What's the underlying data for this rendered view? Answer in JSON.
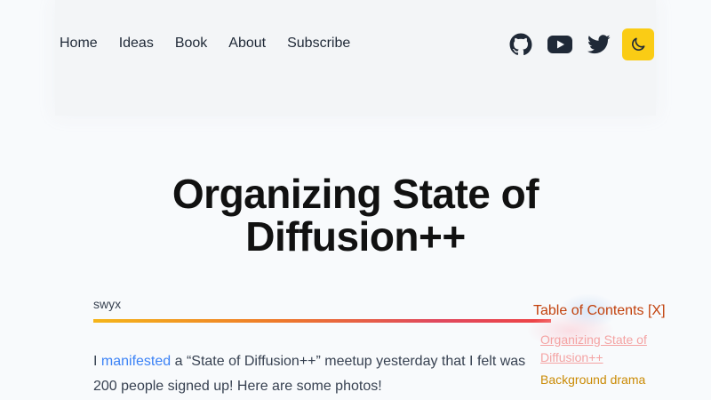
{
  "nav": {
    "items": [
      {
        "label": "Home"
      },
      {
        "label": "Ideas"
      },
      {
        "label": "Book"
      },
      {
        "label": "About"
      },
      {
        "label": "Subscribe"
      }
    ]
  },
  "social": {
    "icons": [
      "github-icon",
      "youtube-icon",
      "twitter-icon"
    ],
    "theme_toggle_icon": "moon-icon",
    "theme_toggle_color": "#facc15"
  },
  "article": {
    "title_line1": "Organizing State of",
    "title_line2": "Diffusion++",
    "author": "swyx",
    "para_lead": "I ",
    "para_link": "manifested",
    "para_rest": " a “State of Diffusion++” meetup yesterday that I felt was",
    "para_line2": "200 people signed up! Here are some photos!"
  },
  "toc": {
    "heading": "Table of Contents [X]",
    "items": [
      {
        "label": "Organizing State of Diffusion++"
      },
      {
        "label": "Background drama"
      }
    ]
  },
  "colors": {
    "link": "#3b82f6",
    "toc_heading": "#c2410c",
    "toc_active": "#f4a3a3",
    "toc_item": "#ca8a04"
  }
}
